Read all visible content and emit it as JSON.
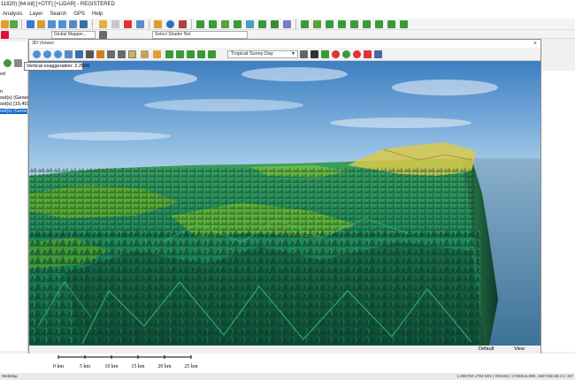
{
  "app": {
    "title": "11820) [64-bit] [+OTF] [+LiDAR] - REGISTERED"
  },
  "menu": {
    "items": [
      "Analysis",
      "Layer",
      "Search",
      "GPS",
      "Help"
    ]
  },
  "main_toolbar": {
    "combo1": "Global Mapper...",
    "combo2": "Select Shader Not"
  },
  "left_panel": {
    "rows": [
      "xd",
      "",
      "n",
      "ost(s) (Genera",
      "ost(s) [10,403",
      "ost(s) (Genera"
    ],
    "selected_index": 5
  },
  "viewer": {
    "title": "3D Viewer",
    "tooltip": "Vertical exaggeration: 2.2500",
    "sky_preset": "Tropical Sunny Day",
    "status_left": "Default",
    "status_right": "View"
  },
  "scale": {
    "labels": [
      "0 km",
      "5 km",
      "10 km",
      "15 km",
      "20 km",
      "25 km"
    ]
  },
  "statusbar": {
    "left": "WebMap",
    "right": "1:266750 UTM 54N | WGS84 | 1706015.09E, 4827460.55 m | 437"
  },
  "colors": {
    "sky_top": "#3d7fc2",
    "sky_horizon": "#c9ddf0",
    "terrain_low": "#5fae2c",
    "terrain_mid": "#1a9c6a",
    "terrain_shadow": "#0d3a2a",
    "terrain_high": "#d9c94a",
    "ocean": "#4a7fa6",
    "selection": "#0a64c8"
  }
}
